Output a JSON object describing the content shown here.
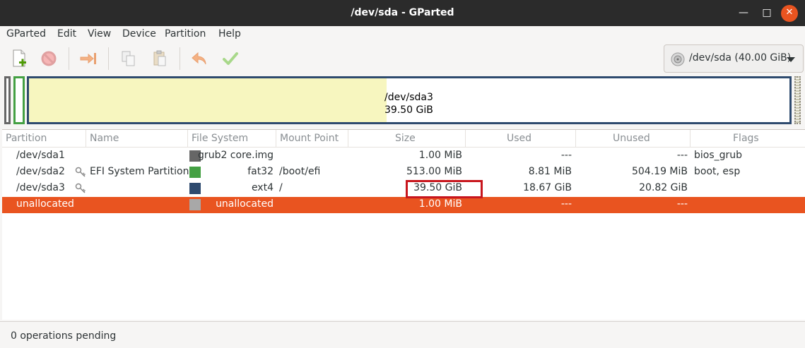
{
  "window": {
    "title": "/dev/sda - GParted",
    "min_glyph": "—",
    "max_glyph": "□",
    "close_glyph": "✕"
  },
  "menu": [
    "GParted",
    "Edit",
    "View",
    "Device",
    "Partition",
    "Help"
  ],
  "toolbar": {
    "icons": [
      "new-partition-icon",
      "delete-icon",
      "resize-move-icon",
      "copy-icon",
      "paste-icon",
      "undo-icon",
      "apply-icon"
    ],
    "device": "/dev/sda (40.00 GiB)"
  },
  "diskmap": {
    "partition": "/dev/sda3",
    "size": "39.50 GiB",
    "used_fraction": 0.47
  },
  "table": {
    "headers": [
      "Partition",
      "Name",
      "File System",
      "Mount Point",
      "Size",
      "Used",
      "Unused",
      "Flags"
    ],
    "rows": [
      {
        "partition": "/dev/sda1",
        "name": "",
        "color": "#666666",
        "fs": "grub2 core.img",
        "mount": "",
        "size": "1.00 MiB",
        "used": "---",
        "unused": "---",
        "flags": "bios_grub",
        "key": false
      },
      {
        "partition": "/dev/sda2",
        "name": "EFI System Partition",
        "color": "#44a043",
        "fs": "fat32",
        "mount": "/boot/efi",
        "size": "513.00 MiB",
        "used": "8.81 MiB",
        "unused": "504.19 MiB",
        "flags": "boot, esp",
        "key": true
      },
      {
        "partition": "/dev/sda3",
        "name": "",
        "color": "#2e4a6e",
        "fs": "ext4",
        "mount": "/",
        "size": "39.50 GiB",
        "used": "18.67 GiB",
        "unused": "20.82 GiB",
        "flags": "",
        "key": true
      },
      {
        "partition": "unallocated",
        "name": "",
        "color": "#a8a8a8",
        "fs": "unallocated",
        "mount": "",
        "size": "1.00 MiB",
        "used": "---",
        "unused": "---",
        "flags": "",
        "key": false
      }
    ]
  },
  "status": "0 operations pending",
  "colors": {
    "accent": "#e95420",
    "titlebar": "#2b2b2b",
    "highlight": "#c8161d"
  }
}
